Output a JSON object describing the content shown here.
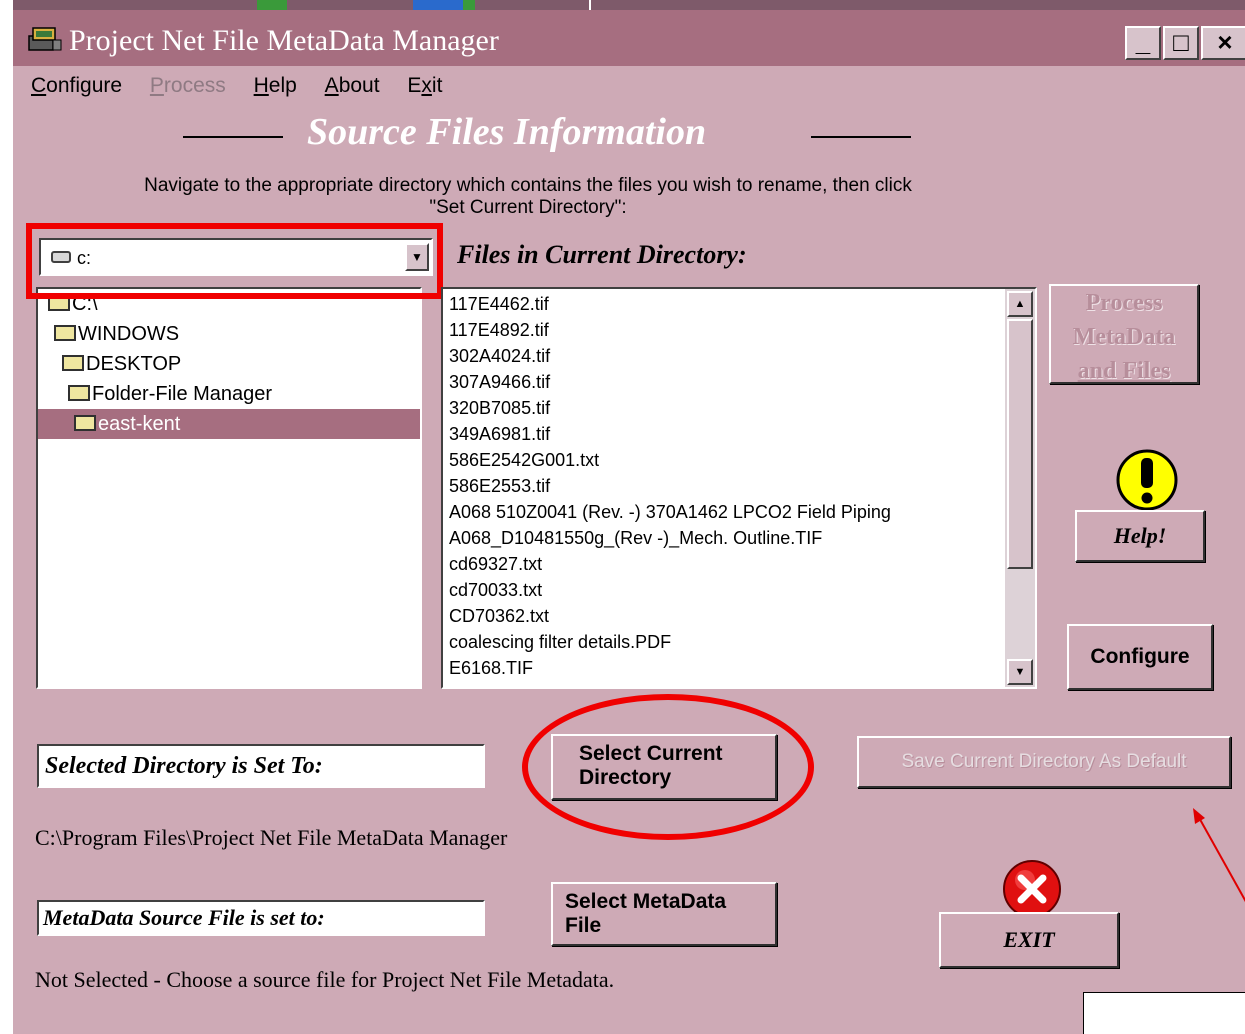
{
  "window": {
    "title": "Project Net File MetaData Manager",
    "min_label": "_",
    "max_label": "□",
    "close_label": "×"
  },
  "menu": {
    "configure": "onfigure",
    "configure_ul": "C",
    "process": "rocess",
    "process_ul": "P",
    "help": "elp",
    "help_ul": "H",
    "about": "bout",
    "about_ul": "A",
    "exit_pre": "E",
    "exit_ul": "x",
    "exit_post": "it"
  },
  "section": {
    "title": "Source Files Information",
    "instruction_line1": "Navigate to the appropriate directory which contains the files you wish to rename, then click",
    "instruction_line2": "\"Set Current Directory\":"
  },
  "drive": {
    "value": "c:",
    "icon": "drive-icon"
  },
  "directory_tree": [
    {
      "label": "C:\\",
      "selected": false
    },
    {
      "label": "WINDOWS",
      "selected": false
    },
    {
      "label": "DESKTOP",
      "selected": false
    },
    {
      "label": "Folder-File Manager",
      "selected": false
    },
    {
      "label": "east-kent",
      "selected": true
    }
  ],
  "files": {
    "label": "Files in Current Directory:",
    "items": [
      "117E4462.tif",
      "117E4892.tif",
      "302A4024.tif",
      "307A9466.tif",
      "320B7085.tif",
      "349A6981.tif",
      "586E2542G001.txt",
      "586E2553.tif",
      "A068 510Z0041 (Rev. -) 370A1462  LPCO2 Field Piping",
      "A068_D10481550g_(Rev -)_Mech. Outline.TIF",
      "cd69327.txt",
      "cd70033.txt",
      "CD70362.txt",
      "coalescing filter details.PDF",
      "E6168.TIF"
    ]
  },
  "buttons": {
    "process_line1": "Process",
    "process_line2": "MetaData",
    "process_line3": "and Files",
    "help": "Help!",
    "configure": "Configure",
    "select_dir_line1": "Select Current",
    "select_dir_line2": "Directory",
    "save_default": "Save Current Directory As Default",
    "select_meta_line1": "Select MetaData",
    "select_meta_line2": "File",
    "exit": "EXIT"
  },
  "selected_directory": {
    "label": "Selected Directory is Set To:",
    "path": "C:\\Program Files\\Project Net File MetaData Manager"
  },
  "metadata_source": {
    "label": "MetaData Source File is set to:",
    "status": "Not Selected - Choose a source file for Project Net File Metadata."
  },
  "colors": {
    "window_bg": "#ceaab6",
    "titlebar": "#a66e80",
    "selection": "#a66e80",
    "annotation_red": "#f00000"
  }
}
